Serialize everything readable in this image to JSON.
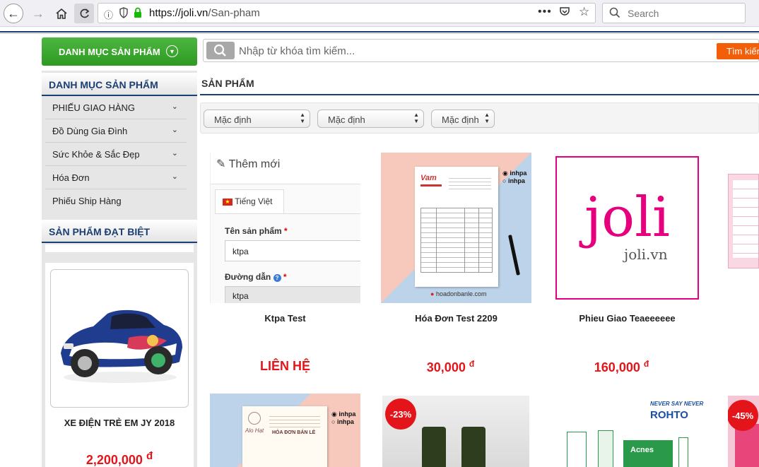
{
  "browser": {
    "url_domain": "https://joli.vn",
    "url_path": "/San-pham",
    "search_placeholder": "Search"
  },
  "sidebar": {
    "category_button": "DANH MỤC SẢN PHẨM",
    "category_title": "DANH MỤC SẢN PHẨM",
    "categories": [
      {
        "label": "PHIẾU GIAO HÀNG",
        "has_children": true
      },
      {
        "label": "Đồ Dùng Gia Đình",
        "has_children": true
      },
      {
        "label": "Sức Khỏe & Sắc Đẹp",
        "has_children": true
      },
      {
        "label": "Hóa Đơn",
        "has_children": true
      },
      {
        "label": "Phiếu Ship Hàng",
        "has_children": false
      }
    ],
    "special_title": "SẢN PHẨM ĐẠT BIỆT",
    "special_product": {
      "name": "XE ĐIỆN TRẺ EM JY 2018",
      "price": "2,200,000",
      "currency": "đ"
    }
  },
  "search": {
    "placeholder": "Nhập từ khóa tìm kiếm...",
    "button_label": "Tìm kiếm"
  },
  "main": {
    "section_title": "SẢN PHẨM",
    "filters": [
      "Mặc định",
      "Mặc định",
      "Mặc định"
    ],
    "products": [
      {
        "name": "Ktpa Test",
        "price": "LIÊN HỆ",
        "currency": ""
      },
      {
        "name": "Hóa Đơn Test 2209",
        "price": "30,000",
        "currency": "đ"
      },
      {
        "name": "Phieu Giao Teaeeeeee",
        "price": "160,000",
        "currency": "đ"
      }
    ],
    "ktpa_screenshot": {
      "header": "Thêm mới",
      "tab": "Tiếng Việt",
      "field1_label": "Tên sản phẩm",
      "field1_value": "ktpa",
      "field2_label": "Đường dẫn",
      "field2_value": "ktpa",
      "required_mark": "*"
    },
    "invoice_image": {
      "brand": "inhpa",
      "site": "hoadonbanle.com"
    },
    "joli_logo": {
      "word": "joli",
      "domain": "joli.vn"
    },
    "row2": {
      "brand": "inhpa",
      "shop_name": "Alo Hạt",
      "doc_title": "HÓA ĐƠN BÁN LẺ",
      "badge_left": "-23%",
      "rohto_tagline": "NEVER SAY NEVER",
      "rohto_brand": "ROHTO",
      "acnes": "Acnes",
      "badge_right": "-45%"
    }
  },
  "colors": {
    "accent_blue": "#1b3f73",
    "green_button": "#3aa52c",
    "orange_button": "#f35e08",
    "price_red": "#e3151a",
    "joli_pink": "#e6007e"
  }
}
